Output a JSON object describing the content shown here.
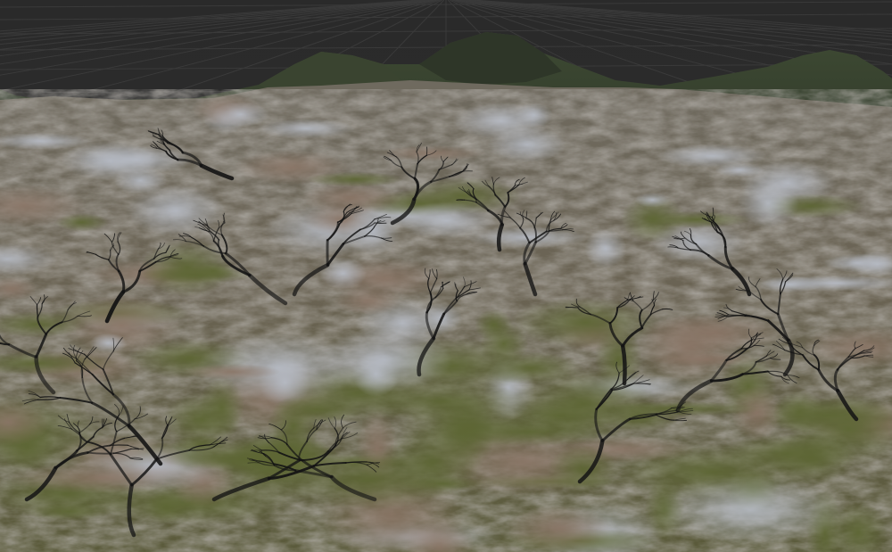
{
  "scene": {
    "type": "3d-terrain-viewport",
    "grid": true,
    "colors": {
      "background": "#2b2b2b",
      "grid_line": "#3a3a3a",
      "grass": "#5b6332",
      "dark_grass": "#2f3a22",
      "rock": "#7a7068",
      "snow_rock": "#a9adb5",
      "crevice": "#141414",
      "mountain_shadow": "#283026"
    }
  }
}
